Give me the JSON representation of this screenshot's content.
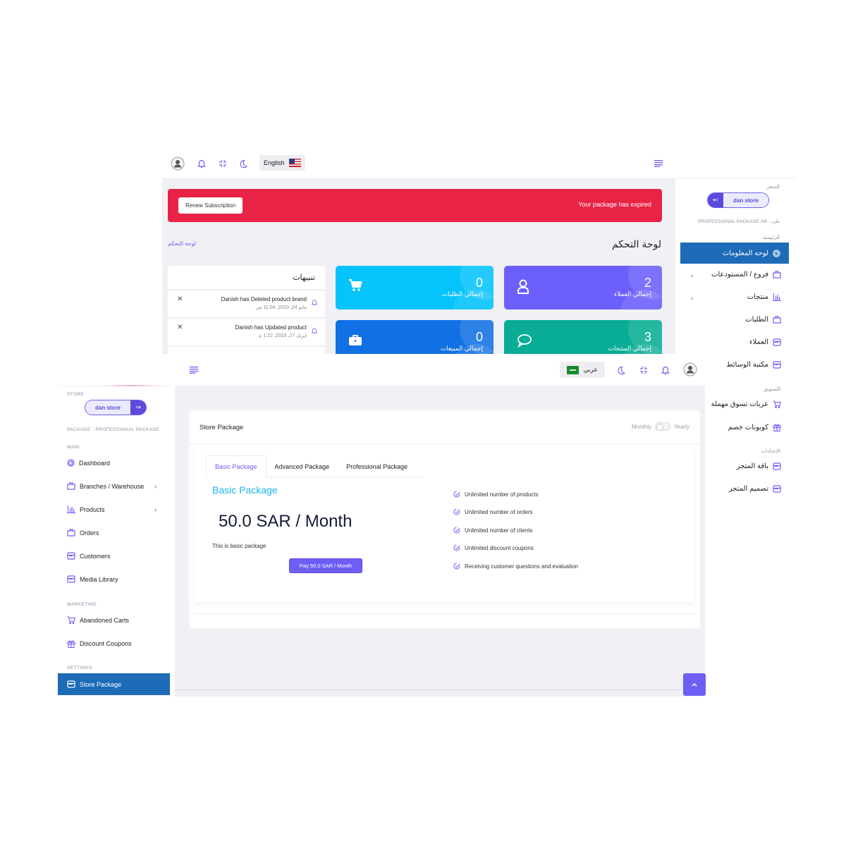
{
  "back_screen": {
    "topbar": {
      "language_label": "English",
      "icons": [
        "user-avatar-icon",
        "bell-icon",
        "compress-icon",
        "moon-icon",
        "flag-us-icon",
        "menu-icon"
      ]
    },
    "alert": {
      "message": "Your package has expired",
      "button_label": "Renew Subscription",
      "color": "#e82346"
    },
    "page_title": "لوحة التحكم",
    "breadcrumb": "لوحة التحكم",
    "notifications": {
      "title": "تنبيهات",
      "items": [
        {
          "text": "Danish has Deleted product brand",
          "date": "مايو 24, 2023, 11:04 ص"
        },
        {
          "text": "Danish has Updated product",
          "date": "إبريل 27, 2023, 1:22 م"
        }
      ]
    },
    "stats": [
      {
        "label": "إجمالي العملاء",
        "value": "2",
        "icon": "user-icon",
        "color": "#6c5ffc"
      },
      {
        "label": "إجمالي الطلبات",
        "value": "0",
        "icon": "cart-icon",
        "color": "#05c3fb"
      },
      {
        "label": "إجمالي المنتجات",
        "value": "3",
        "icon": "chat-icon",
        "color": "#09ad95"
      },
      {
        "label": "إجمالي المبيعات",
        "value": "0",
        "icon": "briefcase-icon",
        "color": "#1170e4"
      }
    ],
    "sidebar": {
      "store_label": "المتجر",
      "store_name": "dan store",
      "package_label": "PROFESSIONAL PACKAGE AR : طرد",
      "sections": [
        {
          "label": "الرئيسية"
        },
        {
          "label": "التسويق"
        },
        {
          "label": "الإعدادات"
        }
      ],
      "items": [
        {
          "label": "لوحه المعلومات",
          "icon": "dashboard-icon",
          "active": true
        },
        {
          "label": "فروع / المستودعات",
          "icon": "bag-icon",
          "has_children": true
        },
        {
          "label": "منتجات",
          "icon": "chart-icon",
          "has_children": true
        },
        {
          "label": "الطلبات",
          "icon": "bag-icon"
        },
        {
          "label": "العملاء",
          "icon": "store-icon"
        },
        {
          "label": "مكتبة الوسائط",
          "icon": "store-icon"
        },
        {
          "label": "عربات تسوق مهملة",
          "icon": "cart-icon"
        },
        {
          "label": "كوبونات خصم",
          "icon": "gift-icon"
        },
        {
          "label": "باقة المتجر",
          "icon": "store-icon"
        },
        {
          "label": "تصميم المتجر",
          "icon": "store-icon"
        }
      ]
    }
  },
  "front_screen": {
    "topbar": {
      "language_label": "عربي",
      "icons": [
        "menu-icon",
        "flag-sa-icon",
        "moon-icon",
        "compress-icon",
        "bell-icon",
        "user-avatar-icon"
      ]
    },
    "sidebar": {
      "store_label": "STORE",
      "store_name": "dan store",
      "package_label": "PACKAGE : PROFESSIONAL PACKAGE",
      "sections": {
        "main": "MAIN",
        "marketing": "MARKETING",
        "settings": "SETTINGS"
      },
      "items": [
        {
          "label": "Dashboard",
          "icon": "dashboard-icon"
        },
        {
          "label": "Branches / Warehouse",
          "icon": "bag-icon",
          "has_children": true
        },
        {
          "label": "Products",
          "icon": "chart-icon",
          "has_children": true
        },
        {
          "label": "Orders",
          "icon": "bag-icon"
        },
        {
          "label": "Customers",
          "icon": "store-icon"
        },
        {
          "label": "Media Library",
          "icon": "store-icon"
        },
        {
          "label": "Abandoned Carts",
          "icon": "cart-icon"
        },
        {
          "label": "Discount Coupons",
          "icon": "gift-icon"
        },
        {
          "label": "Store Package",
          "icon": "store-icon",
          "active": true
        }
      ]
    },
    "store_package": {
      "title": "Store Package",
      "billing_toggle": {
        "left": "Monthly",
        "right": "Yearly",
        "yearly_selected": false
      },
      "tabs": [
        {
          "label": "Basic Package",
          "active": true
        },
        {
          "label": "Advanced Package",
          "active": false
        },
        {
          "label": "Professional Package",
          "active": false
        }
      ],
      "package_name": "Basic Package",
      "price": "50.0 SAR / Month",
      "description": "This is basic package",
      "pay_button": "Pay 50.0 SAR / Month",
      "features": [
        "Unlimited number of products",
        "Unlimited number of orders",
        "Unlimited number of clients",
        "Unlimited discount coupons",
        "Receiving customer questions and evaluation"
      ]
    },
    "scroll_top_icon": "chevron-up-icon"
  },
  "colors": {
    "accent": "#6e5ef5",
    "active_nav": "#1e6bb8",
    "package_name": "#1ab5e8",
    "background": "#f0f0f5"
  }
}
